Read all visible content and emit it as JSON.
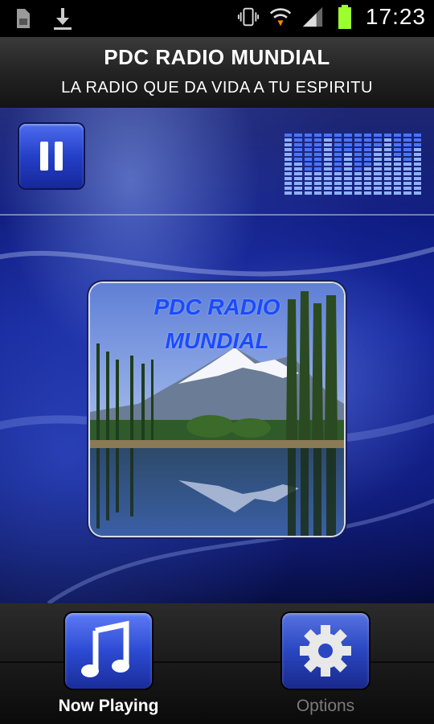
{
  "status_bar": {
    "time": "17:23",
    "icons": [
      "sd-card-icon",
      "download-icon",
      "vibrate-icon",
      "wifi-icon",
      "signal-icon",
      "battery-icon"
    ]
  },
  "header": {
    "title": "PDC RADIO MUNDIAL",
    "subtitle": "LA RADIO QUE DA VIDA A TU ESPIRITU"
  },
  "player": {
    "state": "playing",
    "control_icon": "pause-icon",
    "equalizer_levels": [
      0.9,
      0.55,
      0.35,
      0.35,
      0.9,
      0.35,
      0.7,
      0.35,
      0.45,
      0.8,
      0.9,
      0.6,
      0.5,
      0.75
    ]
  },
  "album_art": {
    "line1": "PDC RADIO",
    "line2": "MUNDIAL"
  },
  "tabs": [
    {
      "label": "Now Playing",
      "icon": "music-note-icon",
      "active": true,
      "label_color": "#ffffff"
    },
    {
      "label": "Options",
      "icon": "gear-icon",
      "active": false,
      "label_color": "#7a7a7a"
    }
  ]
}
